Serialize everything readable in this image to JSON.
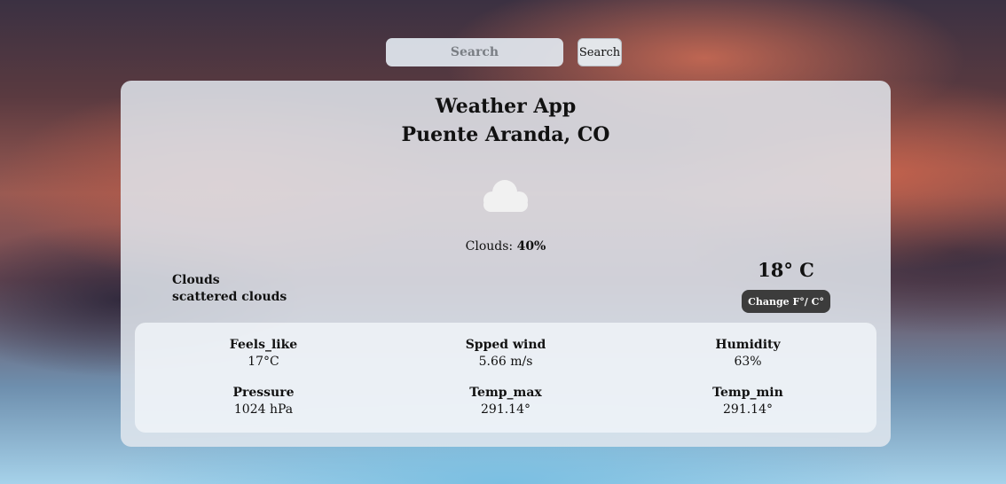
{
  "search": {
    "placeholder": "Search",
    "button_label": "Search"
  },
  "card": {
    "title": "Weather App",
    "location": "Puente Aranda, CO",
    "icon": "cloud-icon",
    "clouds_label": "Clouds: ",
    "clouds_value": "40%",
    "condition_main": "Clouds",
    "condition_desc": "scattered clouds",
    "temperature": "18° C",
    "unit_button_label": "Change F°/ C°"
  },
  "stats": [
    {
      "label": "Feels_like",
      "value": "17°C"
    },
    {
      "label": "Spped wind",
      "value": "5.66 m/s"
    },
    {
      "label": "Humidity",
      "value": "63%"
    },
    {
      "label": "Pressure",
      "value": "1024 hPa"
    },
    {
      "label": "Temp_max",
      "value": "291.14°"
    },
    {
      "label": "Temp_min",
      "value": "291.14°"
    }
  ],
  "colors": {
    "card_background": "#e1e6ed",
    "button_dark": "#3c3c3c",
    "cloud_icon": "#f1f1f1"
  }
}
